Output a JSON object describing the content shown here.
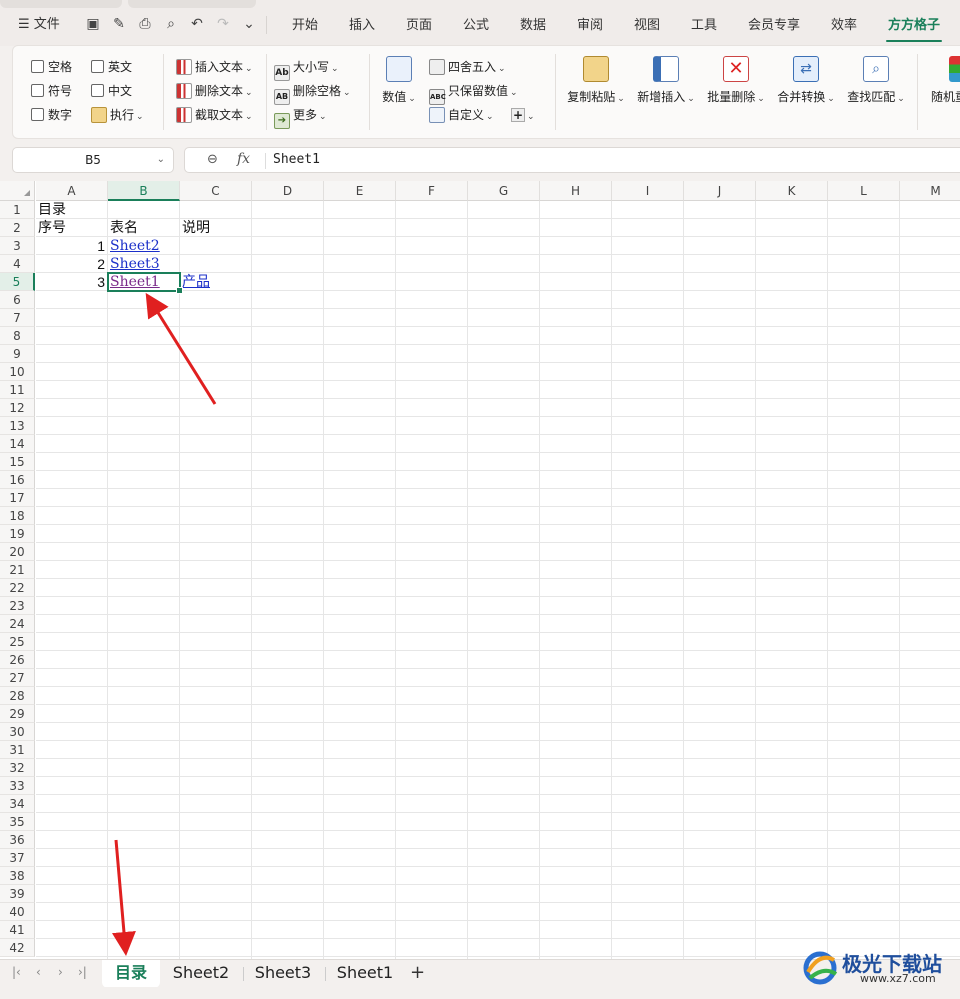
{
  "menubar": {
    "file_label": "文件",
    "tabs": [
      "开始",
      "插入",
      "页面",
      "公式",
      "数据",
      "审阅",
      "视图",
      "工具",
      "会员专享",
      "效率",
      "方方格子"
    ],
    "active_tab": "方方格子"
  },
  "ribbon": {
    "checkboxes": [
      "空格",
      "英文",
      "符号",
      "中文",
      "数字"
    ],
    "execute": "执行",
    "text_tools": [
      "插入文本",
      "删除文本",
      "截取文本"
    ],
    "case_tools": [
      "大小写",
      "删除空格",
      "更多"
    ],
    "number_label": "数值",
    "number_tools": [
      "四舍五入",
      "只保留数值",
      "自定义"
    ],
    "big_buttons": [
      "复制粘贴",
      "新增插入",
      "批量删除",
      "合并转换",
      "查找匹配",
      "随机重"
    ]
  },
  "formula_bar": {
    "name_box": "B5",
    "fx": "fx",
    "value": "Sheet1"
  },
  "sheet": {
    "columns": [
      "A",
      "B",
      "C",
      "D",
      "E",
      "F",
      "G",
      "H",
      "I",
      "J",
      "K",
      "L",
      "M"
    ],
    "selected_column": "B",
    "selected_row": 5,
    "row_count": 42,
    "cells": {
      "A1": "目录",
      "A2": "序号",
      "B2": "表名",
      "C2": "说明",
      "A3": "1",
      "B3": "Sheet2",
      "A4": "2",
      "B4": "Sheet3",
      "A5": "3",
      "B5": "Sheet1",
      "C5": "产品"
    }
  },
  "sheet_tabs": {
    "tabs": [
      "目录",
      "Sheet2",
      "Sheet3",
      "Sheet1"
    ],
    "active": "目录",
    "add": "+"
  },
  "watermark": {
    "title": "极光下载站",
    "url": "www.xz7.com"
  },
  "colors": {
    "accent": "#1a7f5a",
    "link": "#1b2fc9",
    "visited_link": "#7a2a8a",
    "arrow": "#e02020"
  }
}
